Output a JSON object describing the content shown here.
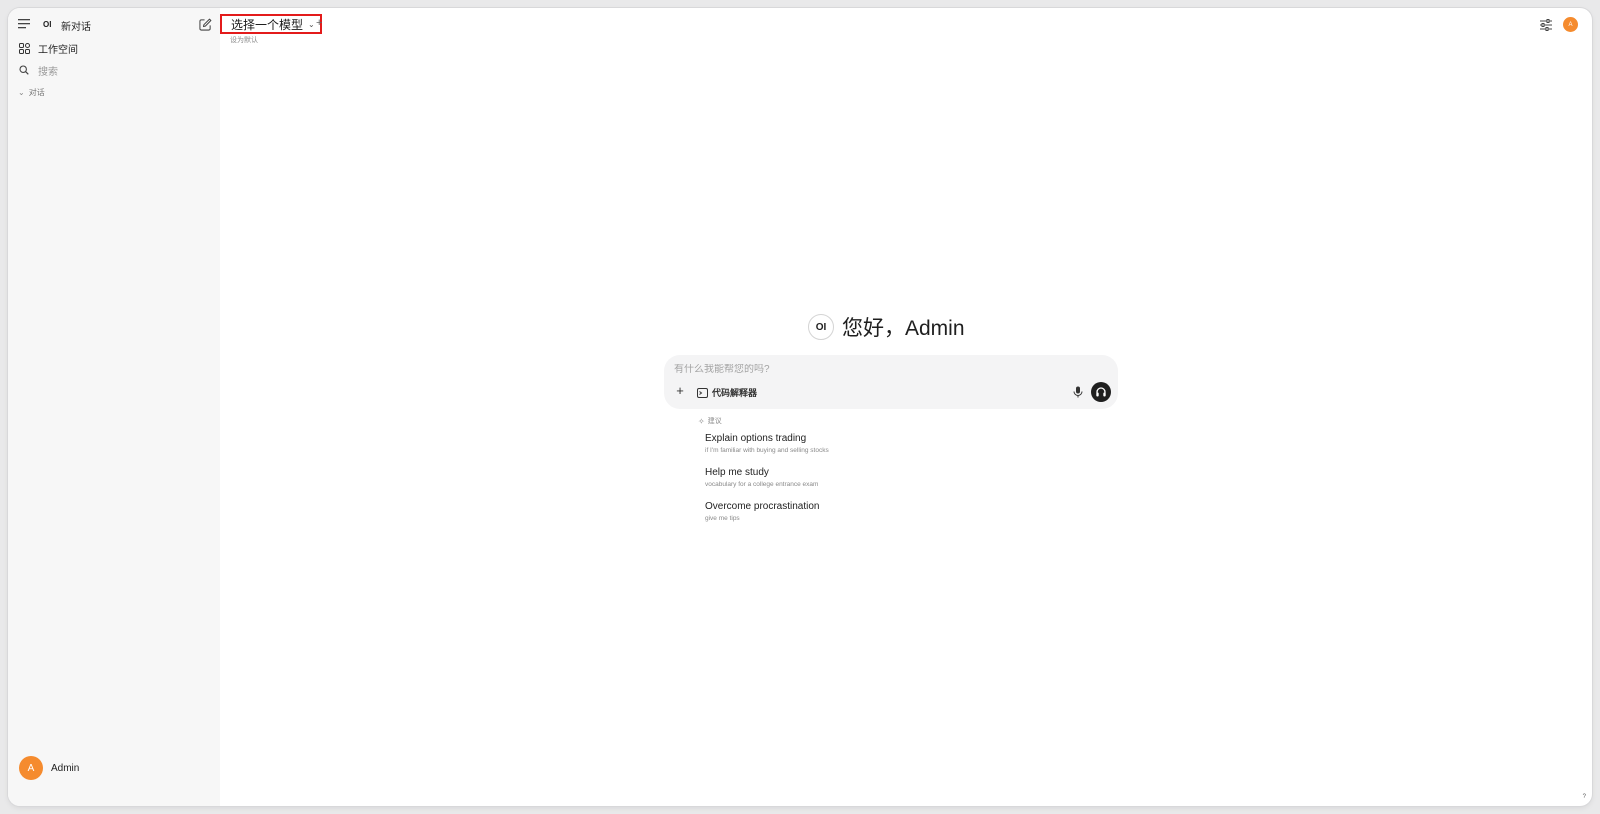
{
  "sidebar": {
    "logo_text": "OI",
    "new_chat_label": "新对话",
    "workspace_label": "工作空间",
    "search_placeholder": "搜索",
    "section_label": "对话",
    "user": {
      "avatar_initial": "A",
      "name": "Admin"
    }
  },
  "header": {
    "model_select_label": "选择一个模型",
    "add_model_label": "+",
    "set_default_label": "设为默认",
    "avatar_initial": "A"
  },
  "main": {
    "logo_text": "OI",
    "greeting": "您好，Admin",
    "composer": {
      "placeholder": "有什么我能帮您的吗?",
      "code_interpreter_label": "代码解释器"
    },
    "suggestions_header": "建议",
    "suggestions": [
      {
        "title": "Explain options trading",
        "subtitle": "if I'm familiar with buying and selling stocks"
      },
      {
        "title": "Help me study",
        "subtitle": "vocabulary for a college entrance exam"
      },
      {
        "title": "Overcome procrastination",
        "subtitle": "give me tips"
      }
    ],
    "help_label": "?"
  },
  "colors": {
    "accent_avatar": "#f58b2e",
    "highlight_border": "#e31b1b",
    "voice_button": "#1f1f1f",
    "sidebar_bg": "#f7f7f7"
  }
}
